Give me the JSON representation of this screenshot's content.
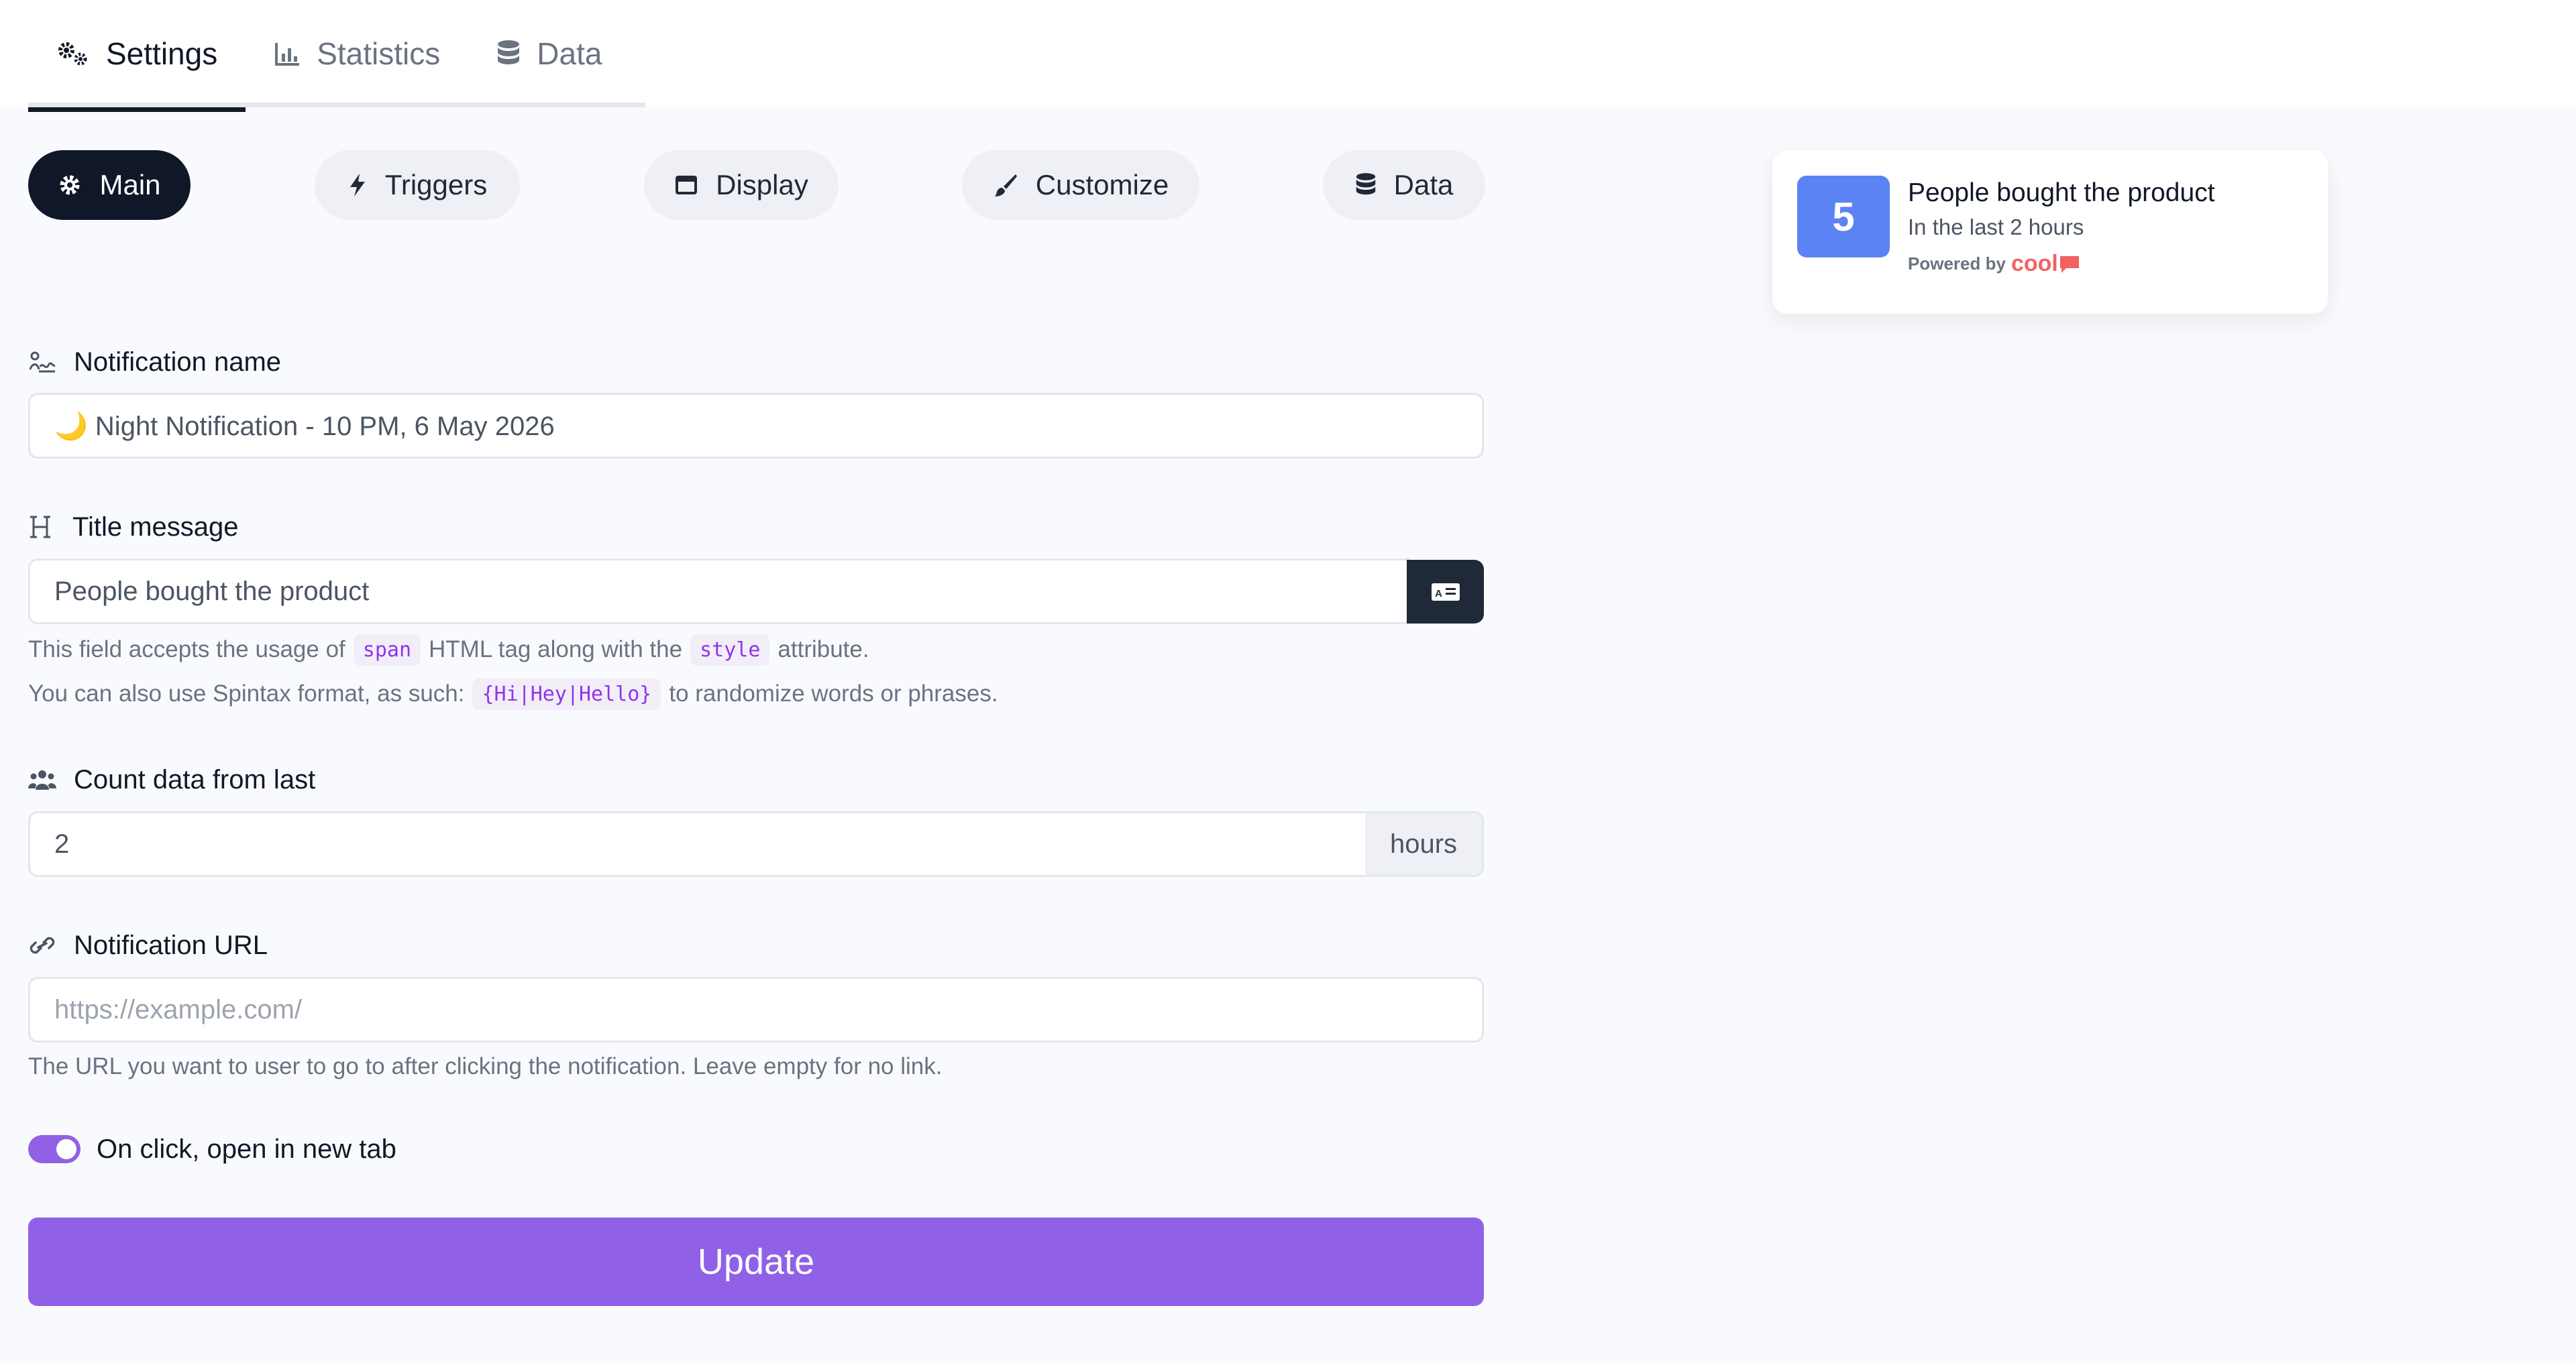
{
  "tabs": [
    {
      "label": "Settings",
      "icon": "gears-icon",
      "active": true
    },
    {
      "label": "Statistics",
      "icon": "chart-icon",
      "active": false
    },
    {
      "label": "Data",
      "icon": "database-icon",
      "active": false
    }
  ],
  "pills": [
    {
      "label": "Main",
      "icon": "gear-icon",
      "active": true
    },
    {
      "label": "Triggers",
      "icon": "bolt-icon"
    },
    {
      "label": "Display",
      "icon": "window-icon"
    },
    {
      "label": "Customize",
      "icon": "brush-icon"
    },
    {
      "label": "Data",
      "icon": "database-icon"
    }
  ],
  "form": {
    "notification_name": {
      "label": "Notification name",
      "value": "🌙 Night Notification - 10 PM, 6 May 2026"
    },
    "title_message": {
      "label": "Title message",
      "value": "People bought the product",
      "help1_a": "This field accepts the usage of",
      "help1_code1": "span",
      "help1_b": "HTML tag along with the",
      "help1_code2": "style",
      "help1_c": "attribute.",
      "help2_a": "You can also use Spintax format, as such:",
      "help2_code": "{Hi|Hey|Hello}",
      "help2_b": "to randomize words or phrases."
    },
    "count_data": {
      "label": "Count data from last",
      "value": "2",
      "suffix": "hours"
    },
    "notification_url": {
      "label": "Notification URL",
      "placeholder": "https://example.com/",
      "help": "The URL you want to user to go to after clicking the notification. Leave empty for no link."
    },
    "new_tab_toggle": {
      "label": "On click, open in new tab",
      "on": true
    },
    "update_label": "Update"
  },
  "preview": {
    "count": "5",
    "title": "People bought the product",
    "subtitle": "In the last 2 hours",
    "powered_by": "Powered by",
    "brand": "cool"
  },
  "colors": {
    "accent": "#9061e6",
    "dark": "#0f1729",
    "badge": "#5b83f4",
    "brand": "#f16363"
  }
}
